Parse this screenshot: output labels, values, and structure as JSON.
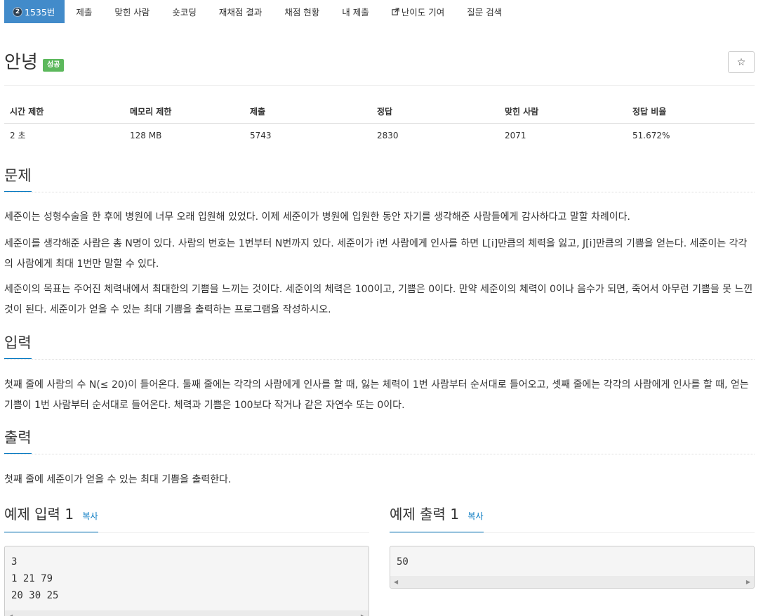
{
  "nav": {
    "problem_number": "1535번",
    "tier_mark": "2",
    "items": [
      "제출",
      "맞힌 사람",
      "숏코딩",
      "재채점 결과",
      "채점 현황",
      "내 제출",
      "난이도 기여",
      "질문 검색"
    ]
  },
  "problem": {
    "title": "안녕",
    "status_badge": "성공",
    "star": "☆"
  },
  "stats": {
    "headers": [
      "시간 제한",
      "메모리 제한",
      "제출",
      "정답",
      "맞힌 사람",
      "정답 비율"
    ],
    "values": [
      "2 초",
      "128 MB",
      "5743",
      "2830",
      "2071",
      "51.672%"
    ]
  },
  "sections": {
    "problem_heading": "문제",
    "problem_p1": "세준이는 성형수술을 한 후에 병원에 너무 오래 입원해 있었다. 이제 세준이가 병원에 입원한 동안 자기를 생각해준 사람들에게 감사하다고 말할 차례이다.",
    "problem_p2": "세준이를 생각해준 사람은 총 N명이 있다. 사람의 번호는 1번부터 N번까지 있다. 세준이가 i번 사람에게 인사를 하면 L[i]만큼의 체력을 잃고, J[i]만큼의 기쁨을 얻는다. 세준이는 각각의 사람에게 최대 1번만 말할 수 있다.",
    "problem_p3": "세준이의 목표는 주어진 체력내에서 최대한의 기쁨을 느끼는 것이다. 세준이의 체력은 100이고, 기쁨은 0이다. 만약 세준이의 체력이 0이나 음수가 되면, 죽어서 아무런 기쁨을 못 느낀 것이 된다. 세준이가 얻을 수 있는 최대 기쁨을 출력하는 프로그램을 작성하시오.",
    "input_heading": "입력",
    "input_p": "첫째 줄에 사람의 수 N(≤ 20)이 들어온다. 둘째 줄에는 각각의 사람에게 인사를 할 때, 잃는 체력이 1번 사람부터 순서대로 들어오고, 셋째 줄에는 각각의 사람에게 인사를 할 때, 얻는 기쁨이 1번 사람부터 순서대로 들어온다. 체력과 기쁨은 100보다 작거나 같은 자연수 또는 0이다.",
    "output_heading": "출력",
    "output_p": "첫째 줄에 세준이가 얻을 수 있는 최대 기쁨을 출력한다."
  },
  "samples": {
    "input_heading": "예제 입력 1",
    "output_heading": "예제 출력 1",
    "copy_label": "복사",
    "input_text": "3\n1 21 79\n20 30 25",
    "output_text": "50"
  }
}
